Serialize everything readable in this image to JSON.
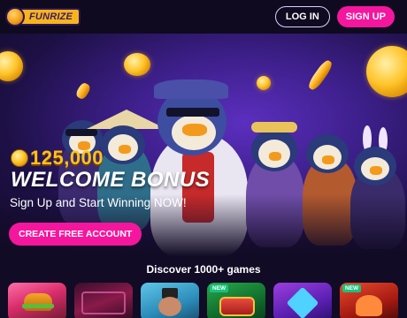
{
  "header": {
    "logo_text": "FUNRIZE",
    "login_label": "LOG IN",
    "signup_label": "SIGN UP"
  },
  "hero": {
    "bonus_amount": "125,000",
    "headline": "WELCOME BONUS",
    "subline": "Sign Up and Start Winning NOW!",
    "cta_label": "CREATE FREE ACCOUNT"
  },
  "games_section": {
    "title": "Discover 1000+ games",
    "cards": [
      {
        "name": "game-card-1",
        "badge": ""
      },
      {
        "name": "game-card-2",
        "badge": ""
      },
      {
        "name": "game-card-3",
        "badge": ""
      },
      {
        "name": "game-card-4",
        "badge": "NEW"
      },
      {
        "name": "game-card-5",
        "badge": ""
      },
      {
        "name": "game-card-6",
        "badge": "NEW"
      }
    ]
  },
  "colors": {
    "accent_pink": "#f5169e",
    "bonus_gold": "#ffc21a",
    "background": "#120b25",
    "new_badge": "#19c37d"
  },
  "icons": [
    "funrize-logo-icon",
    "coin-icon"
  ]
}
